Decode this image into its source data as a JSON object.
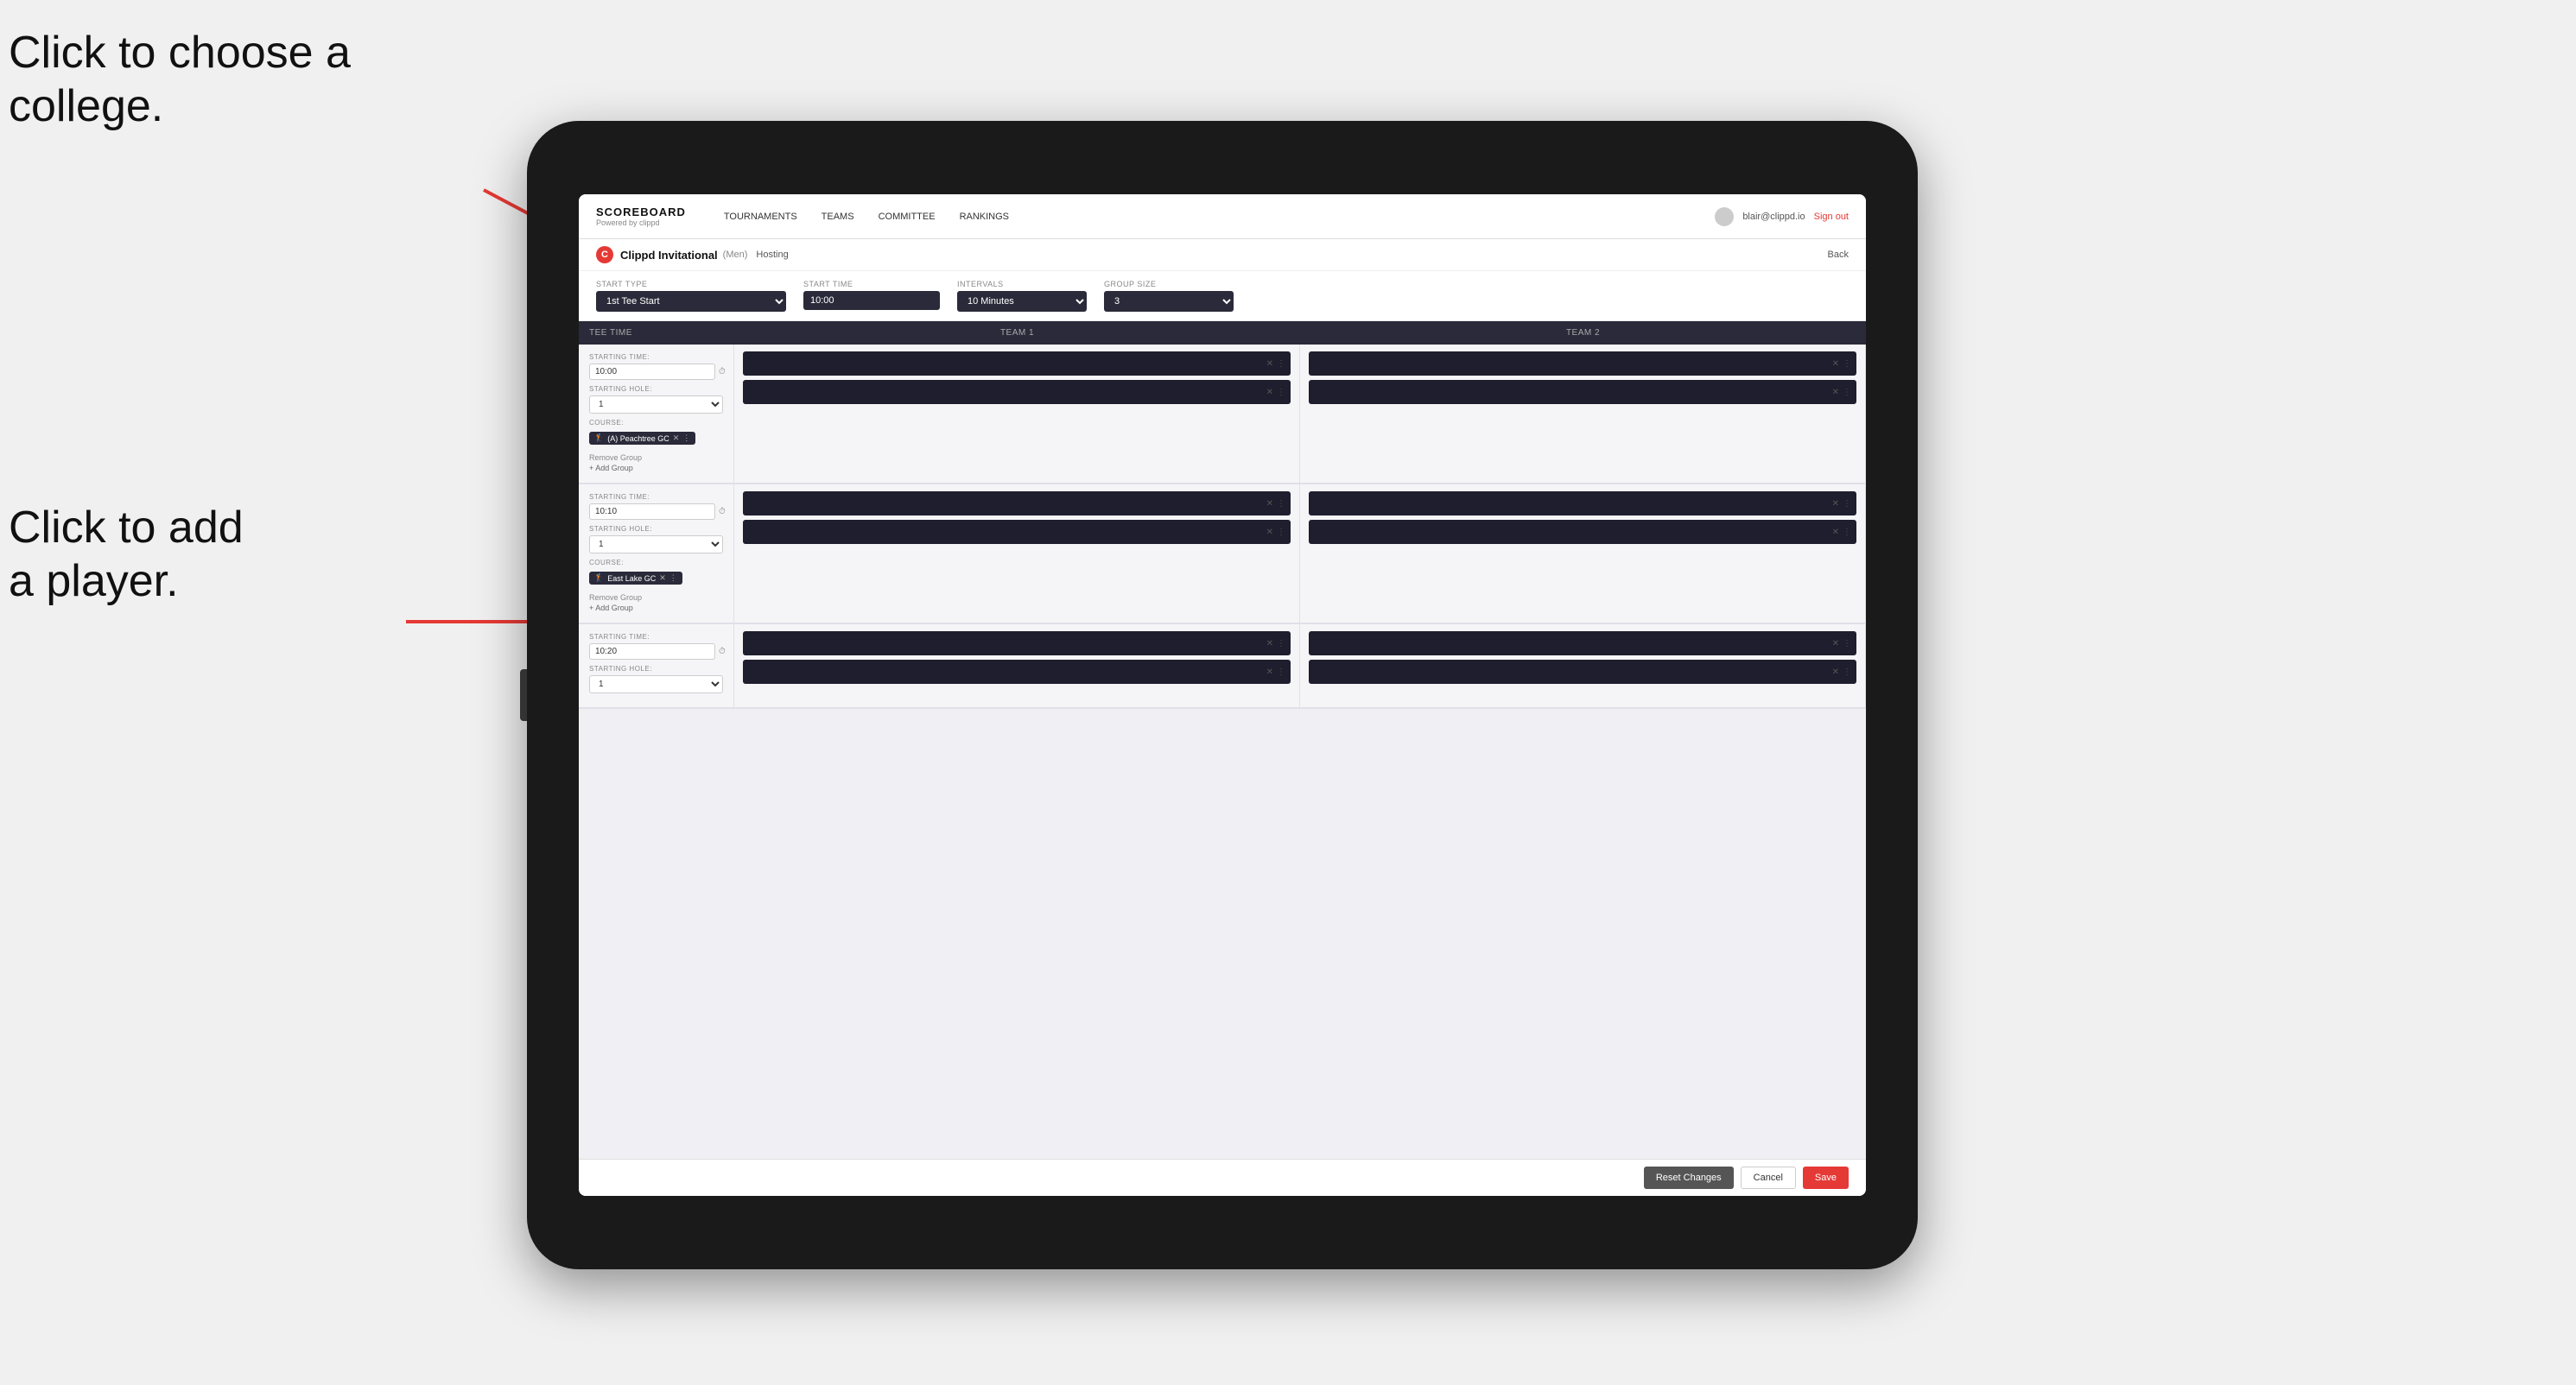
{
  "annotations": {
    "choose_college": "Click to choose a\ncollege.",
    "add_player": "Click to add\na player."
  },
  "navbar": {
    "brand_title": "SCOREBOARD",
    "brand_sub": "Powered by clippd",
    "links": [
      {
        "label": "TOURNAMENTS",
        "active": false
      },
      {
        "label": "TEAMS",
        "active": false
      },
      {
        "label": "COMMITTEE",
        "active": false
      },
      {
        "label": "RANKINGS",
        "active": false
      }
    ],
    "user_email": "blair@clippd.io",
    "sign_out": "Sign out"
  },
  "sub_header": {
    "title": "Clippd Invitational",
    "tag": "(Men)",
    "hosting": "Hosting",
    "back": "Back"
  },
  "form": {
    "start_type_label": "Start Type",
    "start_type_value": "1st Tee Start",
    "start_time_label": "Start Time",
    "start_time_value": "10:00",
    "intervals_label": "Intervals",
    "intervals_value": "10 Minutes",
    "group_size_label": "Group Size",
    "group_size_value": "3"
  },
  "table": {
    "col_tee_time": "Tee Time",
    "col_team1": "Team 1",
    "col_team2": "Team 2"
  },
  "tee_rows": [
    {
      "starting_time": "10:00",
      "starting_hole": "1",
      "course": "(A) Peachtree GC",
      "has_remove_group": true,
      "has_add_group": true,
      "team1_slots": 2,
      "team2_slots": 2
    },
    {
      "starting_time": "10:10",
      "starting_hole": "1",
      "course": "East Lake GC",
      "has_remove_group": true,
      "has_add_group": true,
      "team1_slots": 2,
      "team2_slots": 2
    },
    {
      "starting_time": "10:20",
      "starting_hole": "",
      "course": "",
      "has_remove_group": false,
      "has_add_group": false,
      "team1_slots": 2,
      "team2_slots": 2
    }
  ],
  "buttons": {
    "reset": "Reset Changes",
    "cancel": "Cancel",
    "save": "Save"
  },
  "labels": {
    "starting_time": "STARTING TIME:",
    "starting_hole": "STARTING HOLE:",
    "course": "COURSE:",
    "remove_group": "Remove Group",
    "add_group": "Add Group"
  }
}
